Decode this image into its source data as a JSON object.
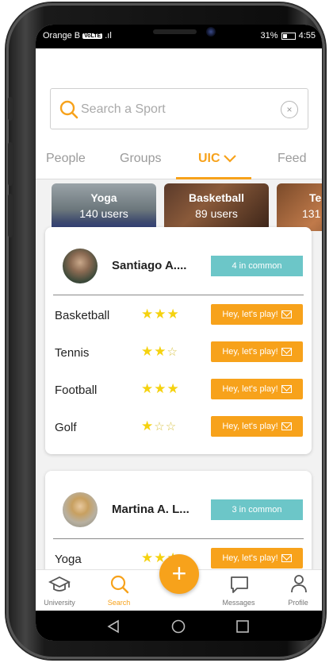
{
  "status_bar": {
    "carrier": "Orange B",
    "network_badge": "VoLTE",
    "signal": ".ıl",
    "battery": "31%",
    "time": "4:55"
  },
  "search": {
    "placeholder": "Search a Sport",
    "value": "",
    "clear_label": "×"
  },
  "tabs": [
    {
      "label": "People",
      "active": false
    },
    {
      "label": "Groups",
      "active": false
    },
    {
      "label": "UIC",
      "active": true
    },
    {
      "label": "Feed",
      "active": false
    }
  ],
  "sports": [
    {
      "name": "Yoga",
      "users": "140 users"
    },
    {
      "name": "Basketball",
      "users": "89 users"
    },
    {
      "name": "Te",
      "users": "131"
    }
  ],
  "users": [
    {
      "name": "Santiago A....",
      "common": "4 in common",
      "sports": [
        {
          "name": "Basketball",
          "rating": 3,
          "action": "Hey, let's play!"
        },
        {
          "name": "Tennis",
          "rating": 2,
          "action": "Hey, let's play!"
        },
        {
          "name": "Football",
          "rating": 3,
          "action": "Hey, let's play!"
        },
        {
          "name": "Golf",
          "rating": 1,
          "action": "Hey, let's play!"
        }
      ]
    },
    {
      "name": "Martina A. L...",
      "common": "3 in common",
      "sports": [
        {
          "name": "Yoga",
          "rating": 3,
          "action": "Hey, let's play!"
        }
      ]
    }
  ],
  "bottom_nav": [
    {
      "label": "University",
      "icon": "graduation-cap-icon",
      "active": false
    },
    {
      "label": "Search",
      "icon": "search-icon",
      "active": true
    },
    {
      "label": "Messages",
      "icon": "message-icon",
      "active": false
    },
    {
      "label": "Profile",
      "icon": "profile-icon",
      "active": false
    }
  ],
  "fab": {
    "label": "+"
  },
  "colors": {
    "accent": "#f7a21b",
    "teal": "#6cc6c8",
    "star": "#f5d20f"
  }
}
